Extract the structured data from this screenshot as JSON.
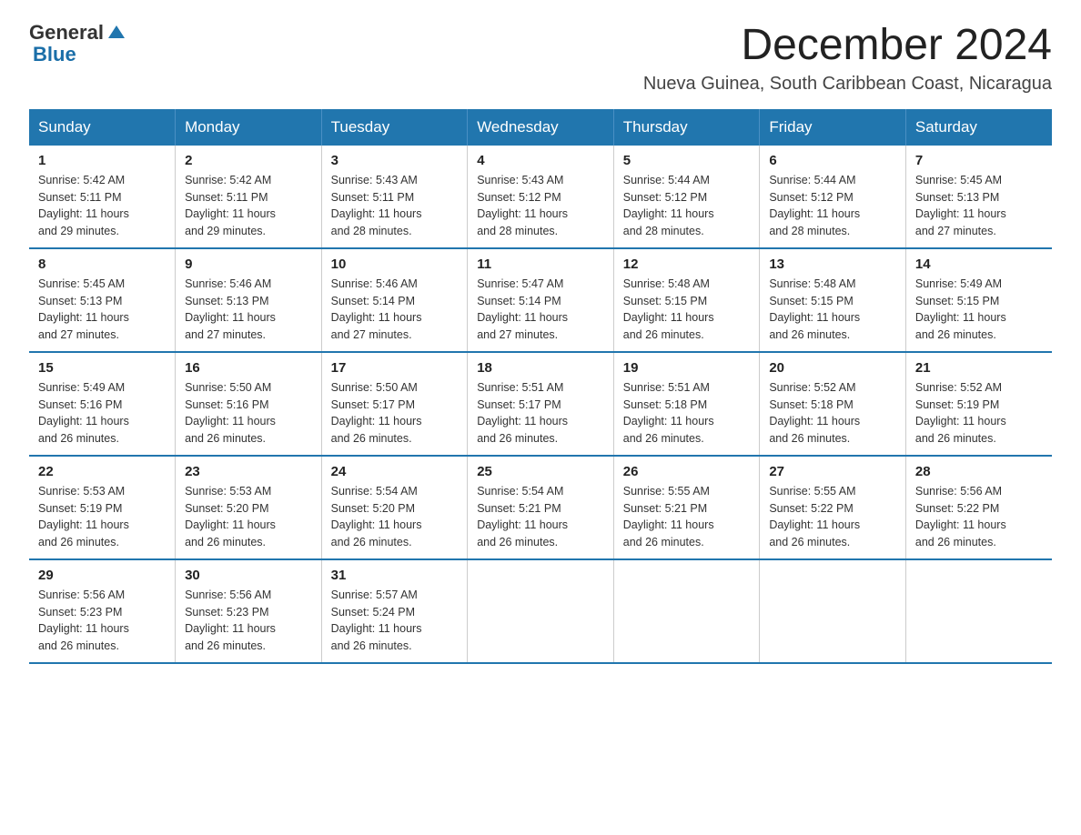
{
  "logo": {
    "general": "General",
    "blue": "Blue"
  },
  "title": "December 2024",
  "subtitle": "Nueva Guinea, South Caribbean Coast, Nicaragua",
  "days_of_week": [
    "Sunday",
    "Monday",
    "Tuesday",
    "Wednesday",
    "Thursday",
    "Friday",
    "Saturday"
  ],
  "weeks": [
    [
      {
        "day": "1",
        "sunrise": "5:42 AM",
        "sunset": "5:11 PM",
        "daylight": "11 hours and 29 minutes."
      },
      {
        "day": "2",
        "sunrise": "5:42 AM",
        "sunset": "5:11 PM",
        "daylight": "11 hours and 29 minutes."
      },
      {
        "day": "3",
        "sunrise": "5:43 AM",
        "sunset": "5:11 PM",
        "daylight": "11 hours and 28 minutes."
      },
      {
        "day": "4",
        "sunrise": "5:43 AM",
        "sunset": "5:12 PM",
        "daylight": "11 hours and 28 minutes."
      },
      {
        "day": "5",
        "sunrise": "5:44 AM",
        "sunset": "5:12 PM",
        "daylight": "11 hours and 28 minutes."
      },
      {
        "day": "6",
        "sunrise": "5:44 AM",
        "sunset": "5:12 PM",
        "daylight": "11 hours and 28 minutes."
      },
      {
        "day": "7",
        "sunrise": "5:45 AM",
        "sunset": "5:13 PM",
        "daylight": "11 hours and 27 minutes."
      }
    ],
    [
      {
        "day": "8",
        "sunrise": "5:45 AM",
        "sunset": "5:13 PM",
        "daylight": "11 hours and 27 minutes."
      },
      {
        "day": "9",
        "sunrise": "5:46 AM",
        "sunset": "5:13 PM",
        "daylight": "11 hours and 27 minutes."
      },
      {
        "day": "10",
        "sunrise": "5:46 AM",
        "sunset": "5:14 PM",
        "daylight": "11 hours and 27 minutes."
      },
      {
        "day": "11",
        "sunrise": "5:47 AM",
        "sunset": "5:14 PM",
        "daylight": "11 hours and 27 minutes."
      },
      {
        "day": "12",
        "sunrise": "5:48 AM",
        "sunset": "5:15 PM",
        "daylight": "11 hours and 26 minutes."
      },
      {
        "day": "13",
        "sunrise": "5:48 AM",
        "sunset": "5:15 PM",
        "daylight": "11 hours and 26 minutes."
      },
      {
        "day": "14",
        "sunrise": "5:49 AM",
        "sunset": "5:15 PM",
        "daylight": "11 hours and 26 minutes."
      }
    ],
    [
      {
        "day": "15",
        "sunrise": "5:49 AM",
        "sunset": "5:16 PM",
        "daylight": "11 hours and 26 minutes."
      },
      {
        "day": "16",
        "sunrise": "5:50 AM",
        "sunset": "5:16 PM",
        "daylight": "11 hours and 26 minutes."
      },
      {
        "day": "17",
        "sunrise": "5:50 AM",
        "sunset": "5:17 PM",
        "daylight": "11 hours and 26 minutes."
      },
      {
        "day": "18",
        "sunrise": "5:51 AM",
        "sunset": "5:17 PM",
        "daylight": "11 hours and 26 minutes."
      },
      {
        "day": "19",
        "sunrise": "5:51 AM",
        "sunset": "5:18 PM",
        "daylight": "11 hours and 26 minutes."
      },
      {
        "day": "20",
        "sunrise": "5:52 AM",
        "sunset": "5:18 PM",
        "daylight": "11 hours and 26 minutes."
      },
      {
        "day": "21",
        "sunrise": "5:52 AM",
        "sunset": "5:19 PM",
        "daylight": "11 hours and 26 minutes."
      }
    ],
    [
      {
        "day": "22",
        "sunrise": "5:53 AM",
        "sunset": "5:19 PM",
        "daylight": "11 hours and 26 minutes."
      },
      {
        "day": "23",
        "sunrise": "5:53 AM",
        "sunset": "5:20 PM",
        "daylight": "11 hours and 26 minutes."
      },
      {
        "day": "24",
        "sunrise": "5:54 AM",
        "sunset": "5:20 PM",
        "daylight": "11 hours and 26 minutes."
      },
      {
        "day": "25",
        "sunrise": "5:54 AM",
        "sunset": "5:21 PM",
        "daylight": "11 hours and 26 minutes."
      },
      {
        "day": "26",
        "sunrise": "5:55 AM",
        "sunset": "5:21 PM",
        "daylight": "11 hours and 26 minutes."
      },
      {
        "day": "27",
        "sunrise": "5:55 AM",
        "sunset": "5:22 PM",
        "daylight": "11 hours and 26 minutes."
      },
      {
        "day": "28",
        "sunrise": "5:56 AM",
        "sunset": "5:22 PM",
        "daylight": "11 hours and 26 minutes."
      }
    ],
    [
      {
        "day": "29",
        "sunrise": "5:56 AM",
        "sunset": "5:23 PM",
        "daylight": "11 hours and 26 minutes."
      },
      {
        "day": "30",
        "sunrise": "5:56 AM",
        "sunset": "5:23 PM",
        "daylight": "11 hours and 26 minutes."
      },
      {
        "day": "31",
        "sunrise": "5:57 AM",
        "sunset": "5:24 PM",
        "daylight": "11 hours and 26 minutes."
      },
      null,
      null,
      null,
      null
    ]
  ],
  "labels": {
    "sunrise": "Sunrise:",
    "sunset": "Sunset:",
    "daylight": "Daylight:"
  }
}
